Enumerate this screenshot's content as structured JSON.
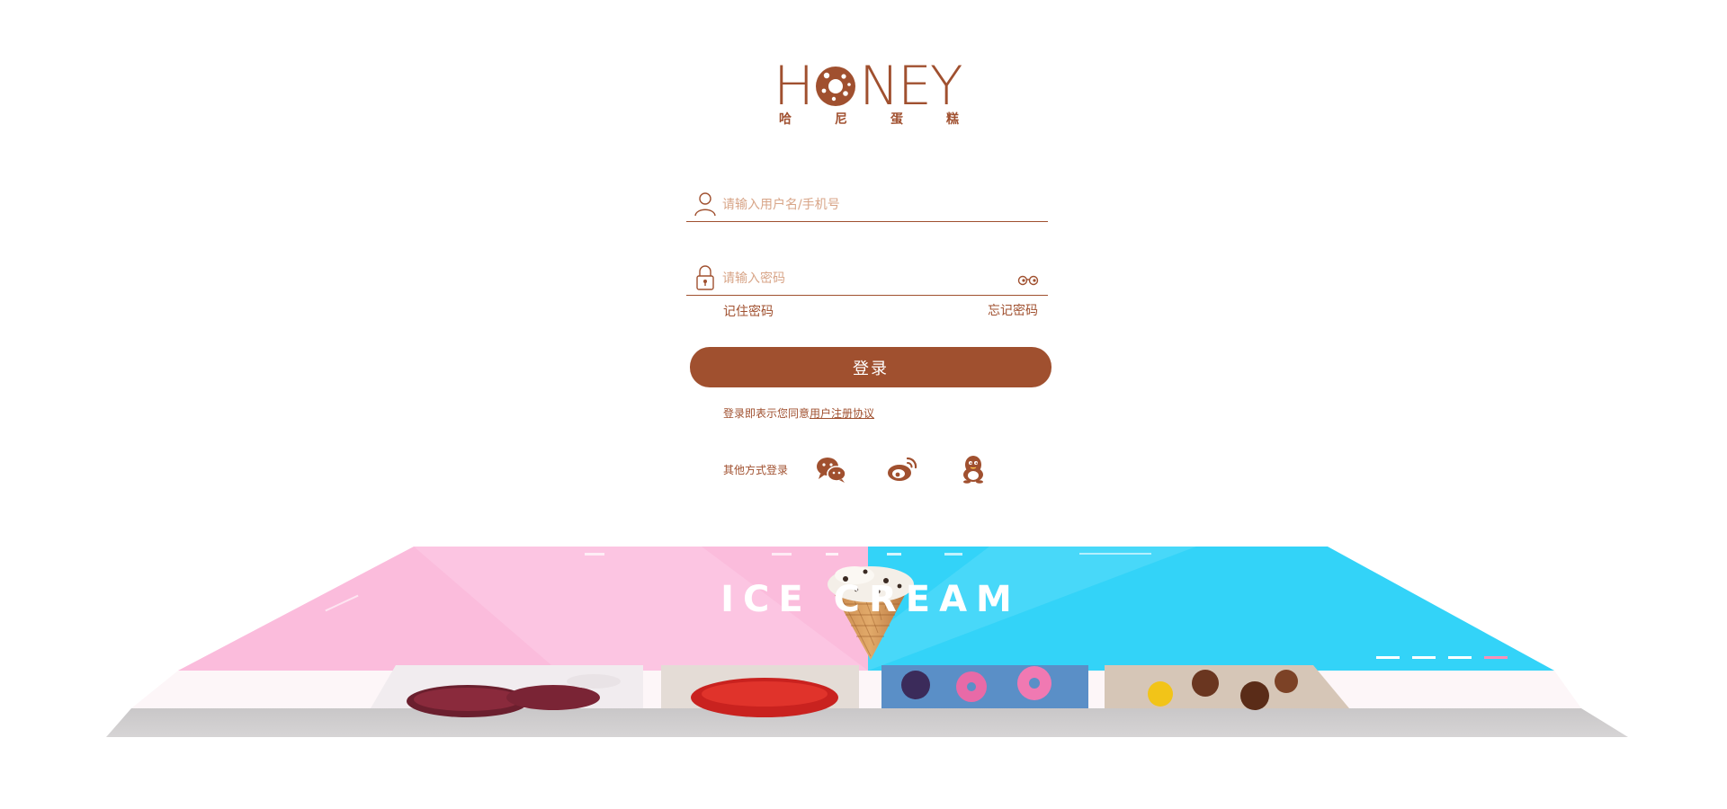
{
  "brand": {
    "logo_word_h": "H",
    "logo_word_rest": "NEY",
    "logo_cn": [
      "哈",
      "尼",
      "蛋",
      "糕"
    ],
    "color": "#a0502f"
  },
  "login": {
    "username_placeholder": "请输入用户名/手机号",
    "password_placeholder": "请输入密码",
    "remember_label": "记住密码",
    "forgot_label": "忘记密码",
    "submit_label": "登录",
    "agreement_prefix": "登录即表示您同意",
    "agreement_link": "用户注册协议",
    "other_login_label": "其他方式登录"
  },
  "social": {
    "wechat_icon": "wechat-icon",
    "weibo_icon": "weibo-icon",
    "qq_icon": "qq-icon"
  },
  "banner": {
    "headline": "ICE CREAM",
    "left_color": "#fbbcdc",
    "right_color": "#33d3f8"
  }
}
